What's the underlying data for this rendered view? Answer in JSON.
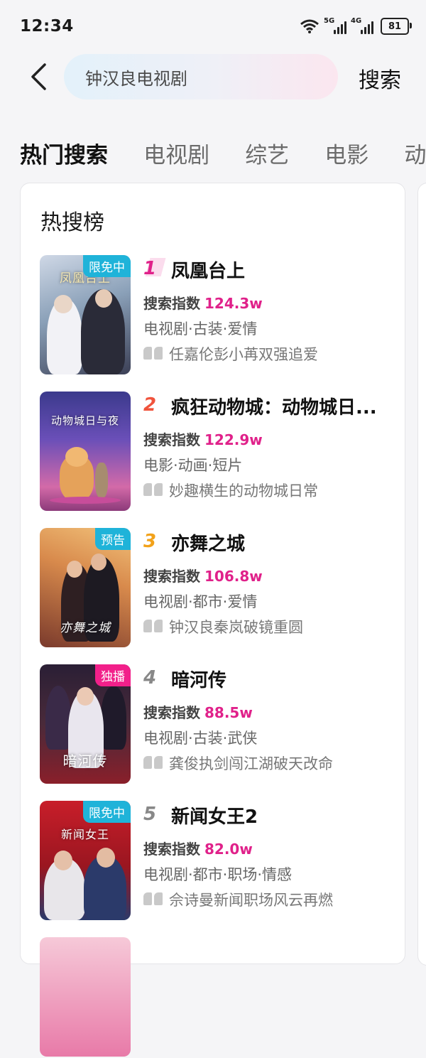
{
  "status": {
    "time": "12:34",
    "net1": "5G",
    "net2": "4G",
    "battery": "81"
  },
  "search": {
    "value": "钟汉良电视剧",
    "button_label": "搜索"
  },
  "tabs": [
    "热门搜索",
    "电视剧",
    "综艺",
    "电影",
    "动"
  ],
  "card": {
    "title": "热搜榜"
  },
  "heat_label": "搜索指数",
  "colors": {
    "accent": "#e0218a",
    "badge_blue": "#1fb3d9",
    "badge_pink": "#f2208a"
  },
  "items": [
    {
      "rank": "1",
      "title": "凤凰台上",
      "heat": "124.3w",
      "tags": "电视剧·古装·爱情",
      "desc": "任嘉伦彭小苒双强追爱",
      "badge": "限免中",
      "poster_text": "凤凰台上"
    },
    {
      "rank": "2",
      "title": "疯狂动物城：动物城日...",
      "heat": "122.9w",
      "tags": "电影·动画·短片",
      "desc": "妙趣横生的动物城日常",
      "badge": "",
      "poster_text": "动物城日与夜"
    },
    {
      "rank": "3",
      "title": "亦舞之城",
      "heat": "106.8w",
      "tags": "电视剧·都市·爱情",
      "desc": "钟汉良秦岚破镜重圆",
      "badge": "预告",
      "poster_text": "亦舞之城"
    },
    {
      "rank": "4",
      "title": "暗河传",
      "heat": "88.5w",
      "tags": "电视剧·古装·武侠",
      "desc": "龚俊执剑闯江湖破天改命",
      "badge": "独播",
      "poster_text": "暗河传"
    },
    {
      "rank": "5",
      "title": "新闻女王2",
      "heat": "82.0w",
      "tags": "电视剧·都市·职场·情感",
      "desc": "佘诗曼新闻职场风云再燃",
      "badge": "限免中",
      "poster_text": "新闻女王"
    }
  ]
}
